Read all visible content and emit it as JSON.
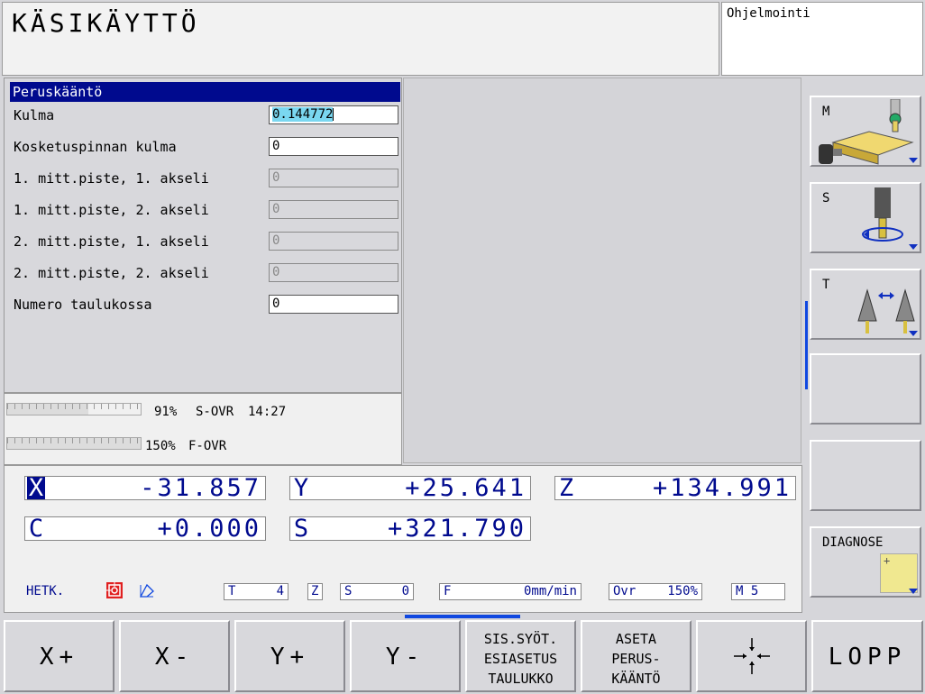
{
  "header": {
    "title": "KÄSIKÄYTTÖ",
    "secondary_mode": "Ohjelmointi"
  },
  "form": {
    "title": "Peruskääntö",
    "fields": [
      {
        "label": "Kulma",
        "value": "0.144772"
      },
      {
        "label": "Kosketuspinnan kulma",
        "value": "0"
      },
      {
        "label": "1. mitt.piste, 1. akseli",
        "value": "0"
      },
      {
        "label": "1. mitt.piste, 2. akseli",
        "value": "0"
      },
      {
        "label": "2. mitt.piste, 1. akseli",
        "value": "0"
      },
      {
        "label": "2. mitt.piste, 2. akseli",
        "value": "0"
      },
      {
        "label": "Numero taulukossa",
        "value": "0"
      }
    ]
  },
  "overrides": {
    "s_ovr": {
      "percent_text": "91%",
      "label": "S-OVR",
      "time": "14:27",
      "level": 0.91
    },
    "f_ovr": {
      "percent_text": "150%",
      "label": "F-OVR",
      "level": 1.0
    }
  },
  "positions": {
    "x": {
      "axis": "X",
      "value": "-31.857"
    },
    "y": {
      "axis": "Y",
      "value": "+25.641"
    },
    "z": {
      "axis": "Z",
      "value": "+134.991"
    },
    "c": {
      "axis": "C",
      "value": "+0.000"
    },
    "s": {
      "axis": "S",
      "value": "+321.790"
    }
  },
  "status": {
    "mode": "HETK.",
    "t": {
      "key": "T",
      "value": "4"
    },
    "z": {
      "key": "Z"
    },
    "s": {
      "key": "S",
      "value": "0"
    },
    "f": {
      "key": "F",
      "value": "0mm/min"
    },
    "ovr": {
      "key": "Ovr",
      "value": "150%"
    },
    "m": {
      "key": "M 5"
    }
  },
  "right_softkeys": [
    {
      "label": "M",
      "icon": "machine-table-icon"
    },
    {
      "label": "S",
      "icon": "spindle-icon"
    },
    {
      "label": "T",
      "icon": "tool-change-icon"
    },
    {
      "label": ""
    },
    {
      "label": ""
    },
    {
      "label": "DIAGNOSE",
      "icon": "diagnose-note-icon"
    }
  ],
  "bottom_softkeys": [
    {
      "label": "X+"
    },
    {
      "label": "X-"
    },
    {
      "label": "Y+"
    },
    {
      "label": "Y-"
    },
    {
      "label": "SIS.SYÖT.\nESIASETUS\nTAULUKKO"
    },
    {
      "label": "ASETA\nPERUS-\nKÄÄNTÖ"
    },
    {
      "label": "",
      "icon": "crosshair-icon"
    },
    {
      "label": "LOPP"
    }
  ],
  "colors": {
    "accent_blue": "#000a8e",
    "selection": "#7ad7f0",
    "highlight_blue": "#1048e0"
  }
}
